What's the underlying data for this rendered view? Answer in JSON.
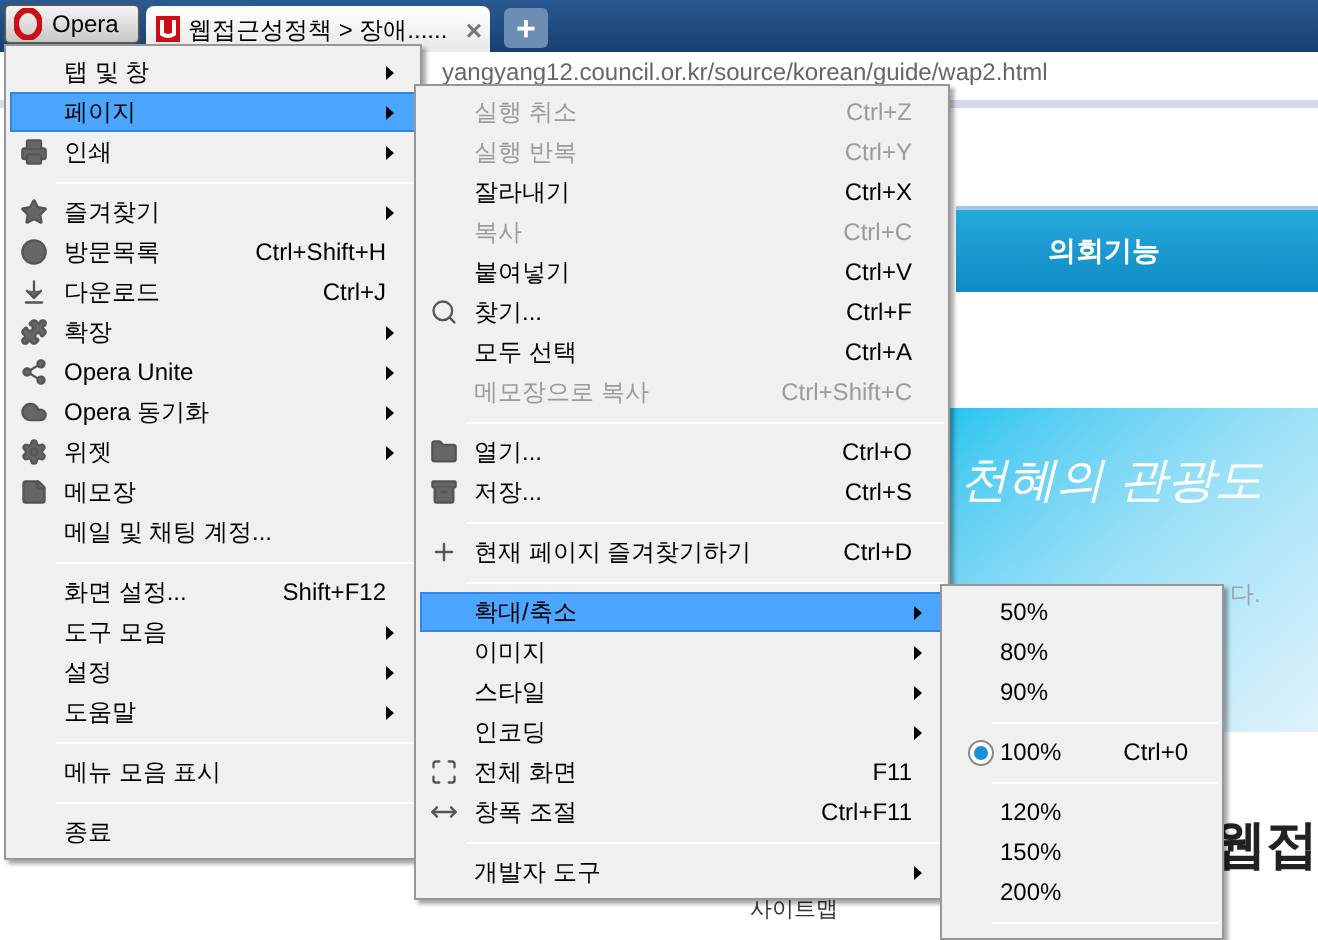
{
  "browser": {
    "menu_button": "Opera",
    "tab": {
      "title": "웹접근성정책 > 장애......",
      "close": "×"
    },
    "new_tab": "+",
    "address": "yangyang12.council.or.kr/source/korean/guide/wap2.html"
  },
  "page": {
    "nav_item": "의회기능",
    "banner_title": "천혜의 관광도",
    "banner_text": "다.",
    "heading": "웹접",
    "footer_link": "사이트맵"
  },
  "main_menu": [
    {
      "kind": "item",
      "label": "탭 및 창",
      "submenu": true,
      "selected": false
    },
    {
      "kind": "item",
      "label": "페이지",
      "submenu": true,
      "selected": true
    },
    {
      "kind": "item",
      "label": "인쇄",
      "submenu": true,
      "selected": false
    },
    {
      "kind": "separator"
    },
    {
      "kind": "item",
      "label": "즐겨찾기",
      "submenu": true,
      "selected": false
    },
    {
      "kind": "item",
      "label": "방문목록",
      "shortcut": "Ctrl+Shift+H",
      "submenu": false,
      "selected": false
    },
    {
      "kind": "item",
      "label": "다운로드",
      "shortcut": "Ctrl+J",
      "submenu": false,
      "selected": false
    },
    {
      "kind": "item",
      "label": "확장",
      "submenu": true,
      "selected": false
    },
    {
      "kind": "item",
      "label": "Opera Unite",
      "submenu": true,
      "selected": false
    },
    {
      "kind": "item",
      "label": "Opera 동기화",
      "submenu": true,
      "selected": false
    },
    {
      "kind": "item",
      "label": "위젯",
      "submenu": true,
      "selected": false
    },
    {
      "kind": "item",
      "label": "메모장",
      "submenu": false,
      "selected": false
    },
    {
      "kind": "item",
      "label": "메일 및 채팅 계정...",
      "submenu": false,
      "selected": false
    },
    {
      "kind": "separator"
    },
    {
      "kind": "item",
      "label": "화면 설정...",
      "shortcut": "Shift+F12",
      "submenu": false,
      "selected": false
    },
    {
      "kind": "item",
      "label": "도구 모음",
      "submenu": true,
      "selected": false
    },
    {
      "kind": "item",
      "label": "설정",
      "submenu": true,
      "selected": false
    },
    {
      "kind": "item",
      "label": "도움말",
      "submenu": true,
      "selected": false
    },
    {
      "kind": "separator"
    },
    {
      "kind": "item",
      "label": "메뉴 모음 표시",
      "submenu": false,
      "selected": false
    },
    {
      "kind": "separator"
    },
    {
      "kind": "item",
      "label": "종료",
      "submenu": false,
      "selected": false
    }
  ],
  "page_menu": [
    {
      "kind": "item",
      "label": "실행 취소",
      "shortcut": "Ctrl+Z",
      "submenu": false,
      "disabled": true,
      "selected": false
    },
    {
      "kind": "item",
      "label": "실행 반복",
      "shortcut": "Ctrl+Y",
      "submenu": false,
      "disabled": true,
      "selected": false
    },
    {
      "kind": "item",
      "label": "잘라내기",
      "shortcut": "Ctrl+X",
      "submenu": false,
      "disabled": false,
      "selected": false
    },
    {
      "kind": "item",
      "label": "복사",
      "shortcut": "Ctrl+C",
      "submenu": false,
      "disabled": true,
      "selected": false
    },
    {
      "kind": "item",
      "label": "붙여넣기",
      "shortcut": "Ctrl+V",
      "submenu": false,
      "disabled": false,
      "selected": false
    },
    {
      "kind": "item",
      "label": "찾기...",
      "shortcut": "Ctrl+F",
      "submenu": false,
      "disabled": false,
      "selected": false
    },
    {
      "kind": "item",
      "label": "모두 선택",
      "shortcut": "Ctrl+A",
      "submenu": false,
      "disabled": false,
      "selected": false
    },
    {
      "kind": "item",
      "label": "메모장으로 복사",
      "shortcut": "Ctrl+Shift+C",
      "submenu": false,
      "disabled": true,
      "selected": false
    },
    {
      "kind": "separator"
    },
    {
      "kind": "item",
      "label": "열기...",
      "shortcut": "Ctrl+O",
      "submenu": false,
      "disabled": false,
      "selected": false
    },
    {
      "kind": "item",
      "label": "저장...",
      "shortcut": "Ctrl+S",
      "submenu": false,
      "disabled": false,
      "selected": false
    },
    {
      "kind": "separator"
    },
    {
      "kind": "item",
      "label": "현재 페이지 즐겨찾기하기",
      "shortcut": "Ctrl+D",
      "submenu": false,
      "disabled": false,
      "selected": false
    },
    {
      "kind": "separator"
    },
    {
      "kind": "item",
      "label": "확대/축소",
      "submenu": true,
      "disabled": false,
      "selected": true
    },
    {
      "kind": "item",
      "label": "이미지",
      "submenu": true,
      "disabled": false,
      "selected": false
    },
    {
      "kind": "item",
      "label": "스타일",
      "submenu": true,
      "disabled": false,
      "selected": false
    },
    {
      "kind": "item",
      "label": "인코딩",
      "submenu": true,
      "disabled": false,
      "selected": false
    },
    {
      "kind": "item",
      "label": "전체 화면",
      "shortcut": "F11",
      "submenu": false,
      "disabled": false,
      "selected": false
    },
    {
      "kind": "item",
      "label": "창폭 조절",
      "shortcut": "Ctrl+F11",
      "submenu": false,
      "disabled": false,
      "selected": false
    },
    {
      "kind": "separator"
    },
    {
      "kind": "item",
      "label": "개발자 도구",
      "submenu": true,
      "disabled": false,
      "selected": false
    }
  ],
  "zoom_menu": [
    {
      "kind": "item",
      "label": "50%",
      "checked": false
    },
    {
      "kind": "item",
      "label": "80%",
      "checked": false
    },
    {
      "kind": "item",
      "label": "90%",
      "checked": false
    },
    {
      "kind": "separator"
    },
    {
      "kind": "item",
      "label": "100%",
      "shortcut": "Ctrl+0",
      "checked": true
    },
    {
      "kind": "separator"
    },
    {
      "kind": "item",
      "label": "120%",
      "checked": false
    },
    {
      "kind": "item",
      "label": "150%",
      "checked": false
    },
    {
      "kind": "item",
      "label": "200%",
      "checked": false
    },
    {
      "kind": "separator"
    }
  ]
}
